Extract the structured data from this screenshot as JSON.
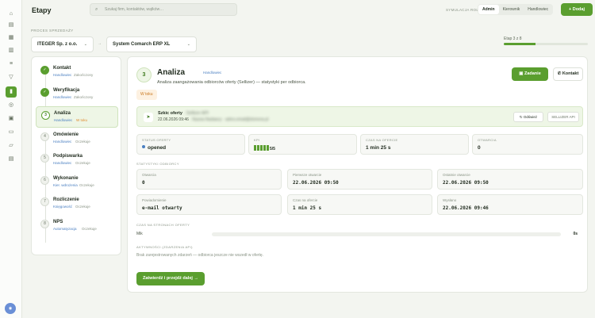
{
  "header": {
    "title": "Etapy",
    "search_placeholder": "Szukaj firm, kontaktów, wątków…"
  },
  "roles": {
    "label": "SYMULACJA ROLI",
    "items": [
      "Admin",
      "Kierownik",
      "Handlowiec"
    ],
    "active": "Admin"
  },
  "add_button": "+ Dodaj",
  "process": {
    "label": "PROCES SPRZEDAŻY",
    "company": "ITEGER Sp. z o.o.",
    "system": "System Comarch ERP XL",
    "stage_count": "Etap 3 z 8",
    "progress": 0.375
  },
  "stages": [
    {
      "num": "✓",
      "name": "Kontakt",
      "role": "Handlowiec",
      "status": "Zakończony",
      "state": "done"
    },
    {
      "num": "✓",
      "name": "Weryfikacja",
      "role": "Handlowiec",
      "status": "Zakończony",
      "state": "done"
    },
    {
      "num": "3",
      "name": "Analiza",
      "role": "Handlowiec",
      "status": "W toku",
      "state": "active"
    },
    {
      "num": "4",
      "name": "Omówienie",
      "role": "Handlowiec",
      "status": "Oczekuje",
      "state": "pending"
    },
    {
      "num": "5",
      "name": "Podpiswarka",
      "role": "Handlowiec",
      "status": "Oczekuje",
      "state": "pending"
    },
    {
      "num": "6",
      "name": "Wykonanie",
      "role": "Kier. wdrożenia",
      "status": "Oczekuje",
      "state": "pending"
    },
    {
      "num": "7",
      "name": "Rozliczenie",
      "role": "Księgowość",
      "status": "Oczekuje",
      "state": "pending"
    },
    {
      "num": "8",
      "name": "NPS",
      "role": "Automatyzacja",
      "status": "Oczekuje",
      "state": "pending"
    }
  ],
  "main": {
    "num": "3",
    "title": "Analiza",
    "role": "Handlowiec",
    "description": "Analiza zaangażowania odbiorców oferty (Sellizer) — statystyki per odbiorca.",
    "task_button": "Zadanie",
    "contact_button": "Kontakt",
    "status_badge": "W toku",
    "draft": {
      "title": "Szkic oferty",
      "title_blur": "· Sellizer API",
      "date": "22.06.2026 09:46",
      "date_blur": "· Nazwa Nadawcy · adres.email@domena.pl",
      "refresh": "Odśwież",
      "api": "SELLIZER API"
    },
    "metrics": [
      {
        "label": "STATUS OFERTY",
        "value": "opened"
      },
      {
        "label": "KPI",
        "value": "5/5",
        "kpi_level": 5
      },
      {
        "label": "CZAS NA OFERCIE",
        "value": "1 min 25 s"
      },
      {
        "label": "OTWARCIA",
        "value": "0"
      }
    ],
    "stats_label": "STATYSTYKI ODBIORCY",
    "stats": [
      {
        "label": "Otwarcia",
        "value": "0"
      },
      {
        "label": "Pierwsze otwarcie",
        "value": "22.06.2026 09:50"
      },
      {
        "label": "Ostatnie otwarcie",
        "value": "22.06.2026 09:50"
      },
      {
        "label": "Powiadomienie",
        "value": "e-mail otwarty"
      },
      {
        "label": "Czas na ofercie",
        "value": "1 min 25 s"
      },
      {
        "label": "Wysłano",
        "value": "22.06.2026 09:46"
      }
    ],
    "time_label": "CZAS NA STRONACH OFERTY",
    "time_row": {
      "label": "Mik",
      "value": "0s"
    },
    "activity_label": "AKTYWNOŚCI (ZDARZENIA API)",
    "no_activity": "Brak zarejestrowanych zdarzeń — odbiorca jeszcze nie wszedł w ofertę.",
    "confirm_button": "Zatwierdź i przejdź dalej →"
  }
}
